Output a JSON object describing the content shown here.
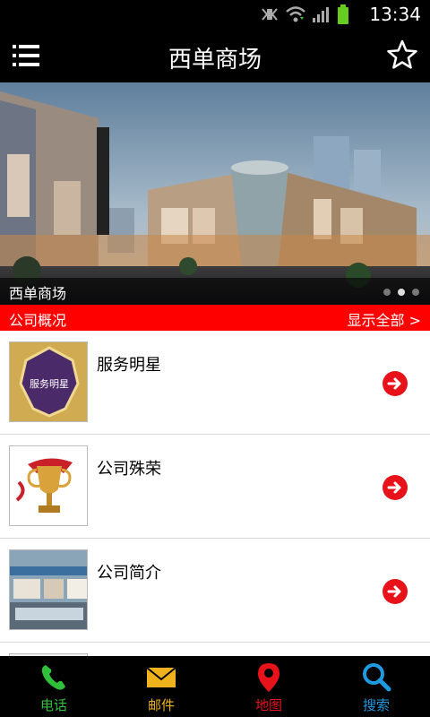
{
  "status_bar": {
    "time": "13:34"
  },
  "header": {
    "title": "西单商场"
  },
  "banner": {
    "caption": "西单商场",
    "slide_count": 3,
    "active_slide": 2
  },
  "section": {
    "title": "公司概况",
    "more_label": "显示全部 >"
  },
  "list": {
    "items": [
      {
        "label": "服务明星",
        "thumb_text": "服务明星"
      },
      {
        "label": "公司殊荣"
      },
      {
        "label": "公司简介"
      }
    ]
  },
  "tabs": [
    {
      "label": "电话",
      "icon": "phone-icon",
      "color": "#2fbf3a"
    },
    {
      "label": "邮件",
      "icon": "mail-icon",
      "color": "#f0b21c"
    },
    {
      "label": "地图",
      "icon": "map-pin-icon",
      "color": "#e8121b"
    },
    {
      "label": "搜索",
      "icon": "search-icon",
      "color": "#1e9ae0"
    }
  ],
  "colors": {
    "accent": "#ff0000",
    "bar": "#000000"
  }
}
